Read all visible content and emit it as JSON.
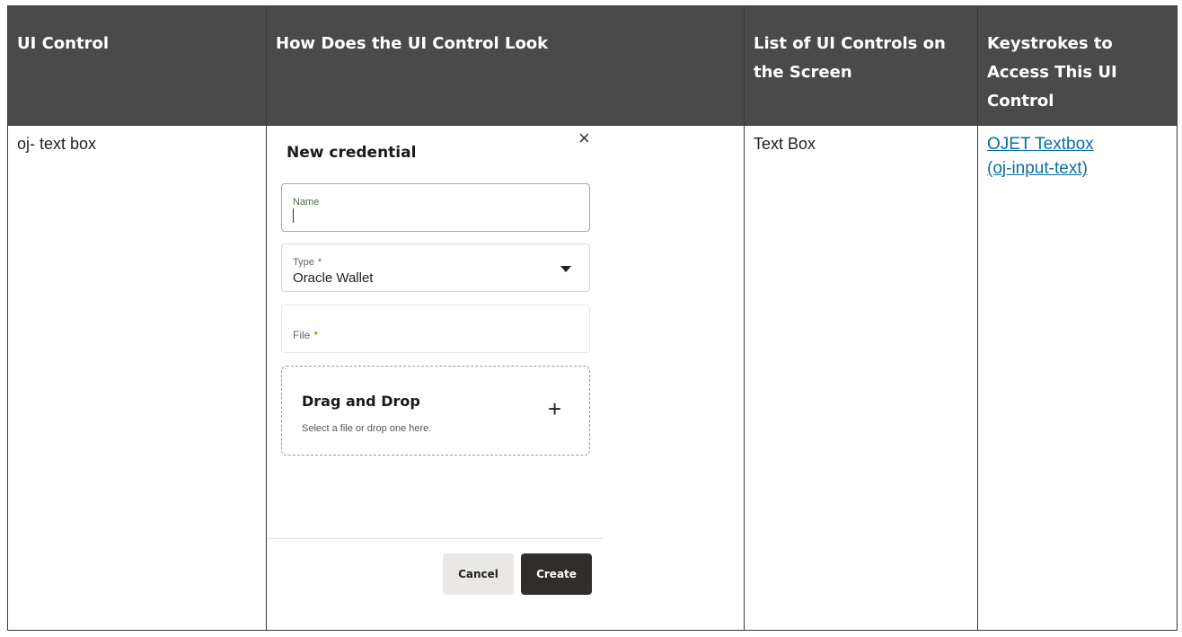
{
  "table": {
    "headers": [
      "UI Control",
      "How Does the UI Control Look",
      "List of UI Controls on the Screen",
      "Keystrokes to Access This UI Control"
    ],
    "row": {
      "control": "oj- text box",
      "list": "Text Box",
      "link_line1": "OJET Textbox",
      "link_line2": "(oj-input-text)"
    }
  },
  "dialog": {
    "close": "×",
    "title": "New credential",
    "name_label": "Name",
    "type_label": "Type",
    "type_value": "Oracle Wallet",
    "required": "*",
    "file_label": "File",
    "drop_title": "Drag and Drop",
    "drop_subtitle": "Select a file or drop one here.",
    "plus": "+",
    "cancel": "Cancel",
    "create": "Create"
  },
  "icons": [
    "close-icon",
    "dropdown-arrow-icon",
    "plus-icon"
  ]
}
